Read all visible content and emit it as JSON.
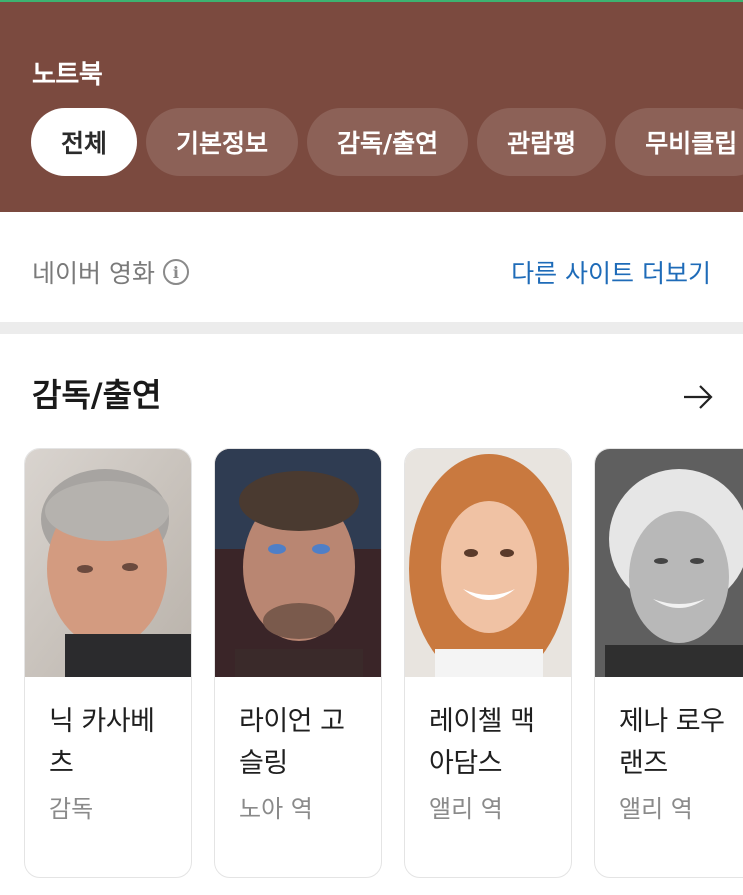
{
  "header": {
    "title": "노트북",
    "tabs": [
      {
        "label": "전체",
        "active": true
      },
      {
        "label": "기본정보",
        "active": false
      },
      {
        "label": "감독/출연",
        "active": false
      },
      {
        "label": "관람평",
        "active": false
      },
      {
        "label": "무비클립",
        "active": false
      }
    ],
    "bg_color": "#7b4a3f"
  },
  "source": {
    "label": "네이버 영화",
    "info_icon": "info-icon",
    "more_link": "다른 사이트 더보기",
    "link_color": "#1e6bb8"
  },
  "section": {
    "title": "감독/출연",
    "arrow_icon": "arrow-right-icon"
  },
  "cast": [
    {
      "name": "닉 카사베츠",
      "role": "감독"
    },
    {
      "name": "라이언 고슬링",
      "role": "노아 역"
    },
    {
      "name": "레이첼 맥아담스",
      "role": "앨리 역"
    },
    {
      "name": "제나 로우랜즈",
      "role": "앨리 역"
    }
  ]
}
